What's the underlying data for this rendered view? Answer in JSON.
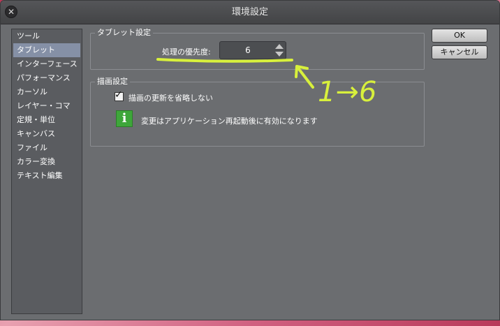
{
  "window": {
    "title": "環境設定"
  },
  "sidebar": {
    "items": [
      {
        "label": "ツール"
      },
      {
        "label": "タブレット",
        "selected": true
      },
      {
        "label": "インターフェース"
      },
      {
        "label": "パフォーマンス"
      },
      {
        "label": "カーソル"
      },
      {
        "label": "レイヤー・コマ"
      },
      {
        "label": "定規・単位"
      },
      {
        "label": "キャンバス"
      },
      {
        "label": "ファイル"
      },
      {
        "label": "カラー変換"
      },
      {
        "label": "テキスト編集"
      }
    ]
  },
  "tablet_settings": {
    "title": "タブレット設定",
    "priority_label": "処理の優先度:",
    "priority_value": "6"
  },
  "drawing_settings": {
    "title": "描画設定",
    "skip_updates_label": "描画の更新を省略しない",
    "skip_updates_checked": true,
    "info_text": "変更はアプリケーション再起動後に有効になります"
  },
  "buttons": {
    "ok": "OK",
    "cancel": "キャンセル"
  },
  "annotation": {
    "text": "1→6",
    "color": "#d8f03c"
  },
  "colors": {
    "panel": "#6b6d70",
    "sidebar_selected": "#8590a6",
    "info_green": "#3ea63a"
  }
}
